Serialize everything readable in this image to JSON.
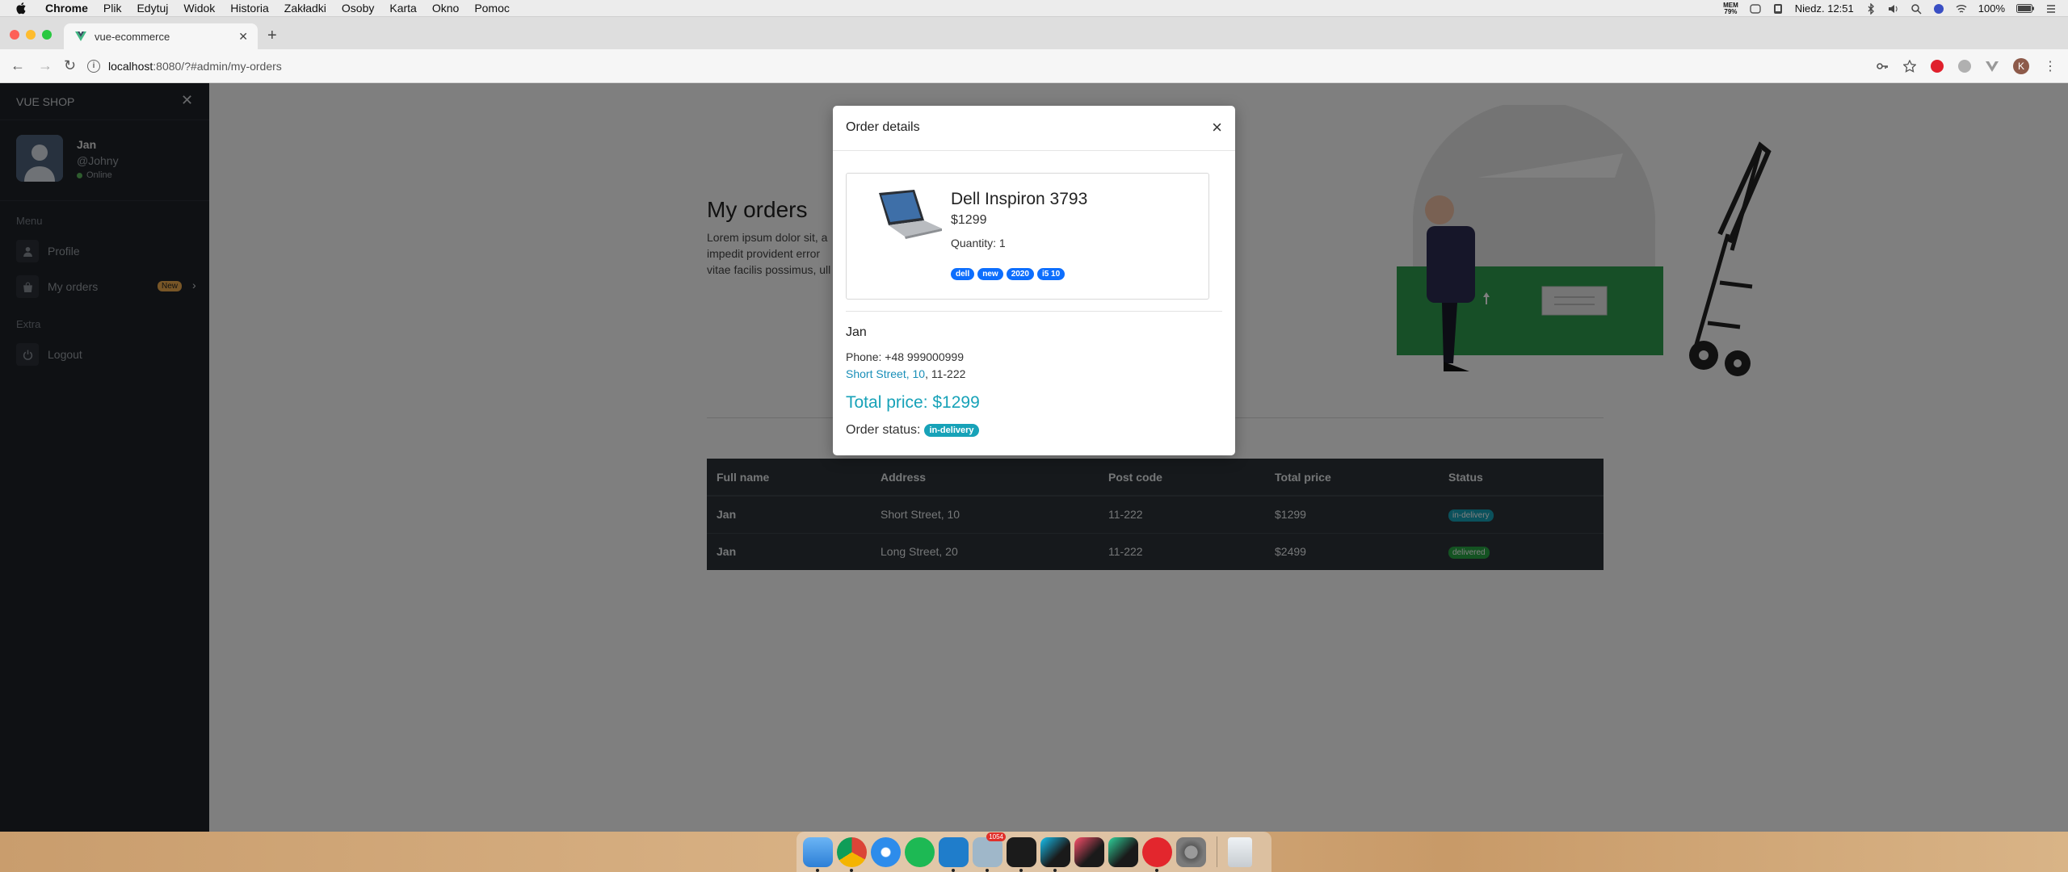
{
  "menubar": {
    "app": "Chrome",
    "items": [
      "Plik",
      "Edytuj",
      "Widok",
      "Historia",
      "Zakładki",
      "Osoby",
      "Karta",
      "Okno",
      "Pomoc"
    ],
    "mem_label": "MEM",
    "mem_value": "79%",
    "clock": "Niedz. 12:51",
    "battery": "100%"
  },
  "browser": {
    "tab_title": "vue-ecommerce",
    "url_host": "localhost",
    "url_path": ":8080/?#admin/my-orders",
    "profile_initial": "K"
  },
  "sidebar": {
    "brand": "VUE SHOP",
    "user": {
      "name": "Jan",
      "handle": "@Johny",
      "status": "Online"
    },
    "menu_heading": "Menu",
    "items": [
      {
        "label": "Profile",
        "icon": "user-icon"
      },
      {
        "label": "My orders",
        "icon": "shopping-bag-icon",
        "badge": "New"
      }
    ],
    "extra_heading": "Extra",
    "extra_items": [
      {
        "label": "Logout",
        "icon": "power-icon"
      }
    ]
  },
  "main": {
    "title": "My orders",
    "intro": "Lorem ipsum dolor sit, a impedit provident error vitae facilis possimus, ull"
  },
  "orders_table": {
    "headers": [
      "Full name",
      "Address",
      "Post code",
      "Total price",
      "Status"
    ],
    "rows": [
      {
        "name": "Jan",
        "address": "Short Street, 10",
        "post_code": "11-222",
        "total": "$1299",
        "status": "in-delivery"
      },
      {
        "name": "Jan",
        "address": "Long Street, 20",
        "post_code": "11-222",
        "total": "$2499",
        "status": "delivered"
      }
    ]
  },
  "modal": {
    "title": "Order details",
    "close": "×",
    "product": {
      "name": "Dell Inspiron 3793",
      "price": "$1299",
      "quantity": "Quantity: 1",
      "tags": [
        "dell",
        "new",
        "2020",
        "i5 10"
      ]
    },
    "customer": "Jan",
    "phone": "Phone: +48 999000999",
    "address_street": "Short Street, 10",
    "address_post": ", 11-222",
    "total": "Total price: $1299",
    "status_label": "Order status:",
    "status_value": "in-delivery"
  },
  "dock": {
    "apps": [
      "finder-icon",
      "chrome-icon",
      "safari-icon",
      "spotify-icon",
      "vscode-icon",
      "preview-icon",
      "terminal-icon",
      "webstorm-icon",
      "intellij-icon",
      "clion-icon",
      "pdf-reader-icon",
      "system-preferences-icon"
    ],
    "mail_badge": "1054",
    "trash": "trash-icon"
  },
  "colors": {
    "sidebar_bg": "#1e2229",
    "table_bg": "#2d3338",
    "info": "#17a2b8",
    "success": "#28a745",
    "tag_blue": "#0d6efd",
    "badge_warning": "#f0ad4e"
  }
}
